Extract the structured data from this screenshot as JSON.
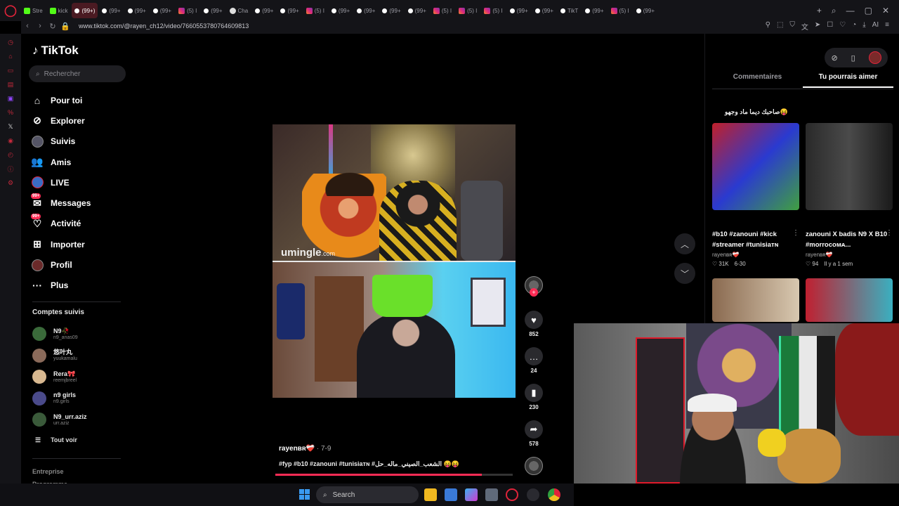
{
  "browser": {
    "tabs": [
      {
        "label": "Stre",
        "fav": "kick",
        "active": false
      },
      {
        "label": "kick",
        "fav": "kick",
        "active": false
      },
      {
        "label": "(99+)",
        "fav": "tt",
        "active": true
      },
      {
        "label": "(99+",
        "fav": "tt",
        "active": false
      },
      {
        "label": "(99+",
        "fav": "tt",
        "active": false
      },
      {
        "label": "(99+",
        "fav": "tt",
        "active": false
      },
      {
        "label": "(5) I",
        "fav": "ig",
        "active": false
      },
      {
        "label": "(99+",
        "fav": "tt",
        "active": false
      },
      {
        "label": "Cha",
        "fav": "gpt",
        "active": false
      },
      {
        "label": "(99+",
        "fav": "tt",
        "active": false
      },
      {
        "label": "(99+",
        "fav": "tt",
        "active": false
      },
      {
        "label": "(5) I",
        "fav": "ig",
        "active": false
      },
      {
        "label": "(99+",
        "fav": "tt",
        "active": false
      },
      {
        "label": "(99+",
        "fav": "tt",
        "active": false
      },
      {
        "label": "(99+",
        "fav": "tt",
        "active": false
      },
      {
        "label": "(99+",
        "fav": "tt",
        "active": false
      },
      {
        "label": "(5) I",
        "fav": "ig",
        "active": false
      },
      {
        "label": "(5) I",
        "fav": "ig",
        "active": false
      },
      {
        "label": "(5) I",
        "fav": "ig",
        "active": false
      },
      {
        "label": "(99+",
        "fav": "tt",
        "active": false
      },
      {
        "label": "(99+",
        "fav": "tt",
        "active": false
      },
      {
        "label": "TikT",
        "fav": "tt",
        "active": false
      },
      {
        "label": "(99+",
        "fav": "tt",
        "active": false
      },
      {
        "label": "(5) I",
        "fav": "ig",
        "active": false
      },
      {
        "label": "(99+",
        "fav": "tt",
        "active": false
      }
    ],
    "url": "www.tiktok.com/@rayen_ch12/video/7660553780764609813",
    "new_tab": "+",
    "ai_label": "AI"
  },
  "tiktok": {
    "logo": "TikTok",
    "search_placeholder": "Rechercher",
    "menu": [
      {
        "label": "Pour toi",
        "icon": "home-icon"
      },
      {
        "label": "Explorer",
        "icon": "compass-icon"
      },
      {
        "label": "Suivis",
        "icon": "following-avatar-icon"
      },
      {
        "label": "Amis",
        "icon": "friends-icon"
      },
      {
        "label": "LIVE",
        "icon": "live-icon"
      },
      {
        "label": "Messages",
        "icon": "messages-icon",
        "badge": "99+"
      },
      {
        "label": "Activité",
        "icon": "activity-icon",
        "badge": "99+"
      },
      {
        "label": "Importer",
        "icon": "upload-icon"
      },
      {
        "label": "Profil",
        "icon": "profile-avatar-icon"
      },
      {
        "label": "Plus",
        "icon": "more-icon"
      }
    ],
    "followed_title": "Comptes suivis",
    "followed": [
      {
        "name": "N9🥀",
        "handle": "n9_anas09",
        "color": "#3a6a3a"
      },
      {
        "name": "悠叶丸",
        "handle": "yuukamalu",
        "color": "#8a6a5a"
      },
      {
        "name": "Rera🎀",
        "handle": "reemjbreel",
        "color": "#d8b890"
      },
      {
        "name": "n9 girls",
        "handle": "n9.girls",
        "color": "#4a4a8a"
      },
      {
        "name": "N9_urr.aziz",
        "handle": "urr.aziz",
        "color": "#3a5a3a"
      }
    ],
    "see_all": "Tout voir",
    "footer": [
      "Entreprise",
      "Programme"
    ]
  },
  "video": {
    "author": "rayenʙʀ❤️‍🩹",
    "date": "· 7-9",
    "caption": "#fyp #b10 #zanouni #tunisiaᴛɴ #الشعب_الصيني_ماله_حل 😝😝",
    "watermark": "umingle",
    "watermark_suffix": ".com",
    "likes": "852",
    "comments": "24",
    "saves": "230",
    "shares": "578",
    "progress": 0.87
  },
  "right_panel": {
    "tabs": [
      "Commentaires",
      "Tu pourrais aimer"
    ],
    "active_tab": 1,
    "section_caption": "صاحبك ديما ماد وجهو😝",
    "cards": [
      {
        "title": "#b10 #zanouni #kick #streamer #tunisiaᴛɴ",
        "user": "rayenʙʀ❤️‍🩹",
        "likes": "31K",
        "date": "6-30"
      },
      {
        "title": "zanouni X badis N9 X B10 #morrocoᴍᴀ...",
        "user": "rayenʙʀ❤️‍🩹",
        "likes": "94",
        "date": "Il y a 1 sem"
      }
    ]
  },
  "taskbar": {
    "search": "Search"
  }
}
